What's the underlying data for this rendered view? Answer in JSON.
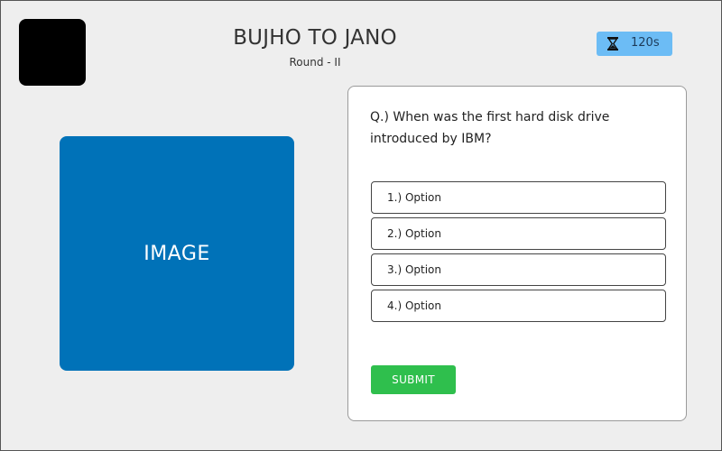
{
  "header": {
    "title": "BUJHO TO JANO",
    "subtitle": "Round - II"
  },
  "timer": {
    "icon": "hourglass-icon",
    "value": "120s"
  },
  "media": {
    "placeholder_label": "IMAGE"
  },
  "quiz": {
    "question": "Q.) When was the first hard disk drive introduced by IBM?",
    "options": [
      "1.) Option",
      "2.) Option",
      "3.) Option",
      "4.) Option"
    ],
    "submit_label": "SUBMIT"
  },
  "colors": {
    "background": "#eeeeee",
    "timer": "#6cbcf5",
    "image_placeholder": "#0072b8",
    "submit": "#2fbf4d"
  }
}
